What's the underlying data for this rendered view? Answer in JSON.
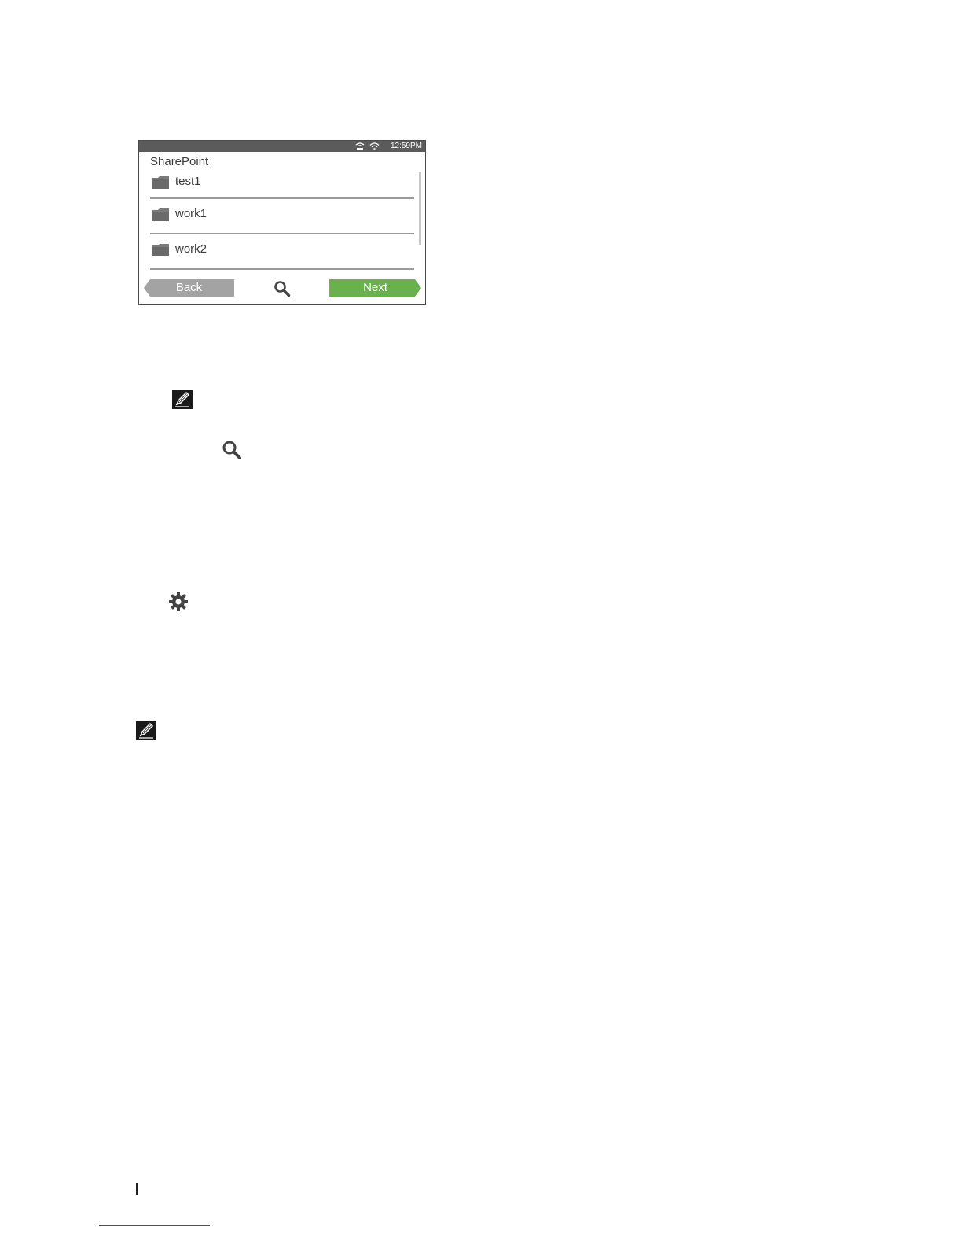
{
  "screen": {
    "status": {
      "time": "12:59PM",
      "icons": [
        "network-icon",
        "wifi-icon"
      ]
    },
    "title": "SharePoint",
    "items": [
      {
        "label": "test1",
        "icon": "folder-icon"
      },
      {
        "label": "work1",
        "icon": "folder-icon"
      },
      {
        "label": "work2",
        "icon": "folder-icon"
      }
    ],
    "buttons": {
      "back": "Back",
      "next": "Next"
    },
    "colors": {
      "status_bar": "#5b5b5b",
      "back": "#a3a3a3",
      "next": "#6ab04c"
    }
  },
  "document": {
    "icons": [
      "note-icon",
      "search-icon",
      "gear-icon",
      "note-icon"
    ]
  }
}
